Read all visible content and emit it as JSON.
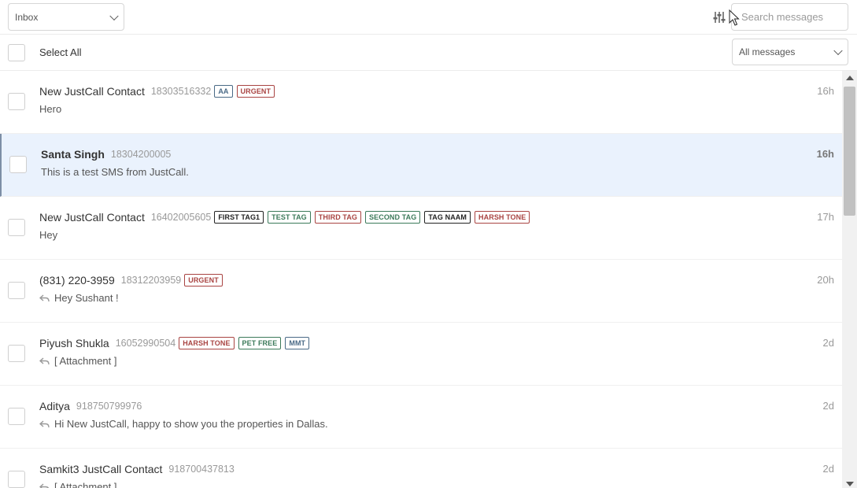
{
  "header": {
    "folder": "Inbox",
    "search_placeholder": "Search messages"
  },
  "toolbar": {
    "select_all": "Select All",
    "message_filter": "All messages"
  },
  "colors": {
    "tag_red": "#a94442",
    "tag_green": "#3c7a5a",
    "tag_blue": "#4a6a86",
    "tag_black": "#222222",
    "active_row": "#eaf2fd"
  },
  "messages": [
    {
      "name": "New JustCall Contact",
      "number": "18303516332",
      "preview": "Hero",
      "time": "16h",
      "unread": false,
      "replied": false,
      "tags": [
        {
          "label": "AA",
          "color": "#4a6a86"
        },
        {
          "label": "URGENT",
          "color": "#a94442"
        }
      ]
    },
    {
      "name": "Santa Singh",
      "number": "18304200005",
      "preview": "This is a test SMS from JustCall.",
      "time": "16h",
      "unread": true,
      "replied": false,
      "tags": []
    },
    {
      "name": "New JustCall Contact",
      "number": "16402005605",
      "preview": "Hey",
      "time": "17h",
      "unread": false,
      "replied": false,
      "tags": [
        {
          "label": "FIRST TAG1",
          "color": "#222222"
        },
        {
          "label": "TEST TAG",
          "color": "#3c7a5a"
        },
        {
          "label": "THIRD TAG",
          "color": "#a94442"
        },
        {
          "label": "SECOND TAG",
          "color": "#3c7a5a"
        },
        {
          "label": "TAG NAAM",
          "color": "#222222"
        },
        {
          "label": "HARSH TONE",
          "color": "#a94442"
        }
      ]
    },
    {
      "name": "(831) 220-3959",
      "number": "18312203959",
      "preview": "Hey Sushant !",
      "time": "20h",
      "unread": false,
      "replied": true,
      "tags": [
        {
          "label": "URGENT",
          "color": "#a94442"
        }
      ]
    },
    {
      "name": "Piyush Shukla",
      "number": "16052990504",
      "preview": "[ Attachment ]",
      "time": "2d",
      "unread": false,
      "replied": true,
      "tags": [
        {
          "label": "HARSH TONE",
          "color": "#a94442"
        },
        {
          "label": "PET FREE",
          "color": "#3c7a5a"
        },
        {
          "label": "MMT",
          "color": "#4a6a86"
        }
      ]
    },
    {
      "name": "Aditya",
      "number": "918750799976",
      "preview": "Hi New JustCall, happy to show you the properties in Dallas.",
      "time": "2d",
      "unread": false,
      "replied": true,
      "tags": []
    },
    {
      "name": "Samkit3 JustCall Contact",
      "number": "918700437813",
      "preview": "[ Attachment ]",
      "time": "2d",
      "unread": false,
      "replied": true,
      "tags": []
    }
  ]
}
